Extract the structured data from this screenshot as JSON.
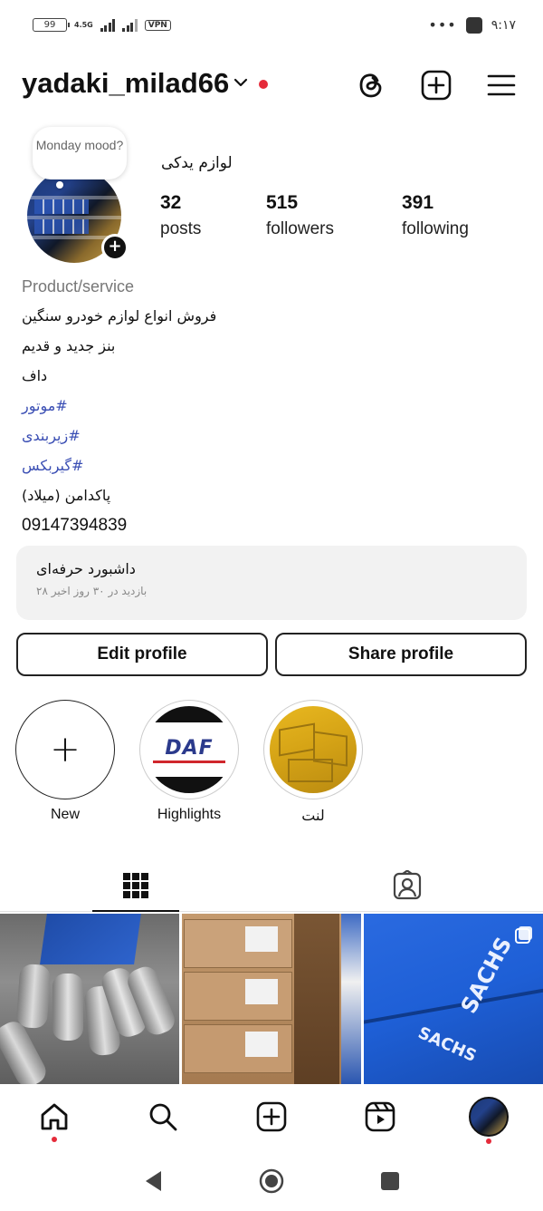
{
  "status_bar": {
    "battery": "99",
    "network": "4.5G",
    "vpn": "VPN",
    "dots": "•••",
    "time": "۹:۱۷"
  },
  "header": {
    "username": "yadaki_milad66"
  },
  "profile": {
    "note": "Monday mood?",
    "display_name": "لوازم یدکی",
    "stats": [
      {
        "value": "32",
        "label": "posts"
      },
      {
        "value": "515",
        "label": "followers"
      },
      {
        "value": "391",
        "label": "following"
      }
    ]
  },
  "bio": {
    "category": "Product/service",
    "line1": "فروش انواع لوازم خودرو سنگین",
    "line2": "بنز جدید و قدیم",
    "line3": "داف",
    "tag1": "موتور#",
    "tag2": "زیربندی#",
    "tag3": "گیربکس#",
    "line4": "پاکدامن (میلاد)",
    "phone": "09147394839"
  },
  "dashboard": {
    "title": "داشبورد حرفه‌ای",
    "subtitle": "۲۸ بازدید در ۳۰ روز اخیر"
  },
  "buttons": {
    "edit": "Edit profile",
    "share": "Share profile"
  },
  "highlights": [
    {
      "label": "New"
    },
    {
      "label": "Highlights",
      "logo_text": "DAF"
    },
    {
      "label": "لنت"
    }
  ],
  "colors": {
    "accent_red": "#e52b3a",
    "hashtag_blue": "#3b4fb4",
    "daf_blue": "#2b3a8c",
    "sachs_blue": "#1e5fd6"
  },
  "grid_posts": [
    {
      "subject": "pistons"
    },
    {
      "subject": "boxes"
    },
    {
      "subject": "sachs-box",
      "brand_text": "SACHS"
    }
  ]
}
